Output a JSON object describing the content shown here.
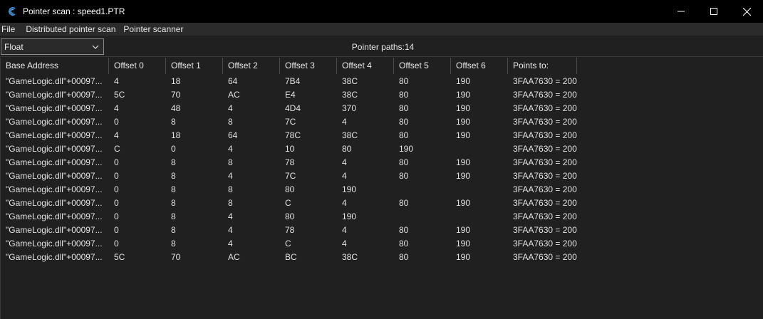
{
  "window": {
    "title": "Pointer scan : speed1.PTR",
    "icon": "cheat-engine-icon"
  },
  "menu": [
    {
      "label": "File"
    },
    {
      "label": "Distributed pointer scan"
    },
    {
      "label": "Pointer scanner"
    }
  ],
  "toolbar": {
    "value_type": "Float",
    "pointer_paths_label": "Pointer paths:14"
  },
  "columns": [
    "Base Address",
    "Offset 0",
    "Offset 1",
    "Offset 2",
    "Offset 3",
    "Offset 4",
    "Offset 5",
    "Offset 6",
    "Points to:"
  ],
  "rows": [
    [
      "\"GameLogic.dll\"+00097...",
      "4",
      "18",
      "64",
      "7B4",
      "38C",
      "80",
      "190",
      "3FAA7630 = 200"
    ],
    [
      "\"GameLogic.dll\"+00097...",
      "5C",
      "70",
      "AC",
      "E4",
      "38C",
      "80",
      "190",
      "3FAA7630 = 200"
    ],
    [
      "\"GameLogic.dll\"+00097...",
      "4",
      "48",
      "4",
      "4D4",
      "370",
      "80",
      "190",
      "3FAA7630 = 200"
    ],
    [
      "\"GameLogic.dll\"+00097...",
      "0",
      "8",
      "8",
      "7C",
      "4",
      "80",
      "190",
      "3FAA7630 = 200"
    ],
    [
      "\"GameLogic.dll\"+00097...",
      "4",
      "18",
      "64",
      "78C",
      "38C",
      "80",
      "190",
      "3FAA7630 = 200"
    ],
    [
      "\"GameLogic.dll\"+00097...",
      "C",
      "0",
      "4",
      "10",
      "80",
      "190",
      "",
      "3FAA7630 = 200"
    ],
    [
      "\"GameLogic.dll\"+00097...",
      "0",
      "8",
      "8",
      "78",
      "4",
      "80",
      "190",
      "3FAA7630 = 200"
    ],
    [
      "\"GameLogic.dll\"+00097...",
      "0",
      "8",
      "4",
      "7C",
      "4",
      "80",
      "190",
      "3FAA7630 = 200"
    ],
    [
      "\"GameLogic.dll\"+00097...",
      "0",
      "8",
      "8",
      "80",
      "190",
      "",
      "",
      "3FAA7630 = 200"
    ],
    [
      "\"GameLogic.dll\"+00097...",
      "0",
      "8",
      "8",
      "C",
      "4",
      "80",
      "190",
      "3FAA7630 = 200"
    ],
    [
      "\"GameLogic.dll\"+00097...",
      "0",
      "8",
      "4",
      "80",
      "190",
      "",
      "",
      "3FAA7630 = 200"
    ],
    [
      "\"GameLogic.dll\"+00097...",
      "0",
      "8",
      "4",
      "78",
      "4",
      "80",
      "190",
      "3FAA7630 = 200"
    ],
    [
      "\"GameLogic.dll\"+00097...",
      "0",
      "8",
      "4",
      "C",
      "4",
      "80",
      "190",
      "3FAA7630 = 200"
    ],
    [
      "\"GameLogic.dll\"+00097...",
      "5C",
      "70",
      "AC",
      "BC",
      "38C",
      "80",
      "190",
      "3FAA7630 = 200"
    ]
  ],
  "colors": {
    "titlebar": "#000000",
    "background": "#202020",
    "menubar": "#2b2b2b",
    "text": "#e2e2e2"
  }
}
